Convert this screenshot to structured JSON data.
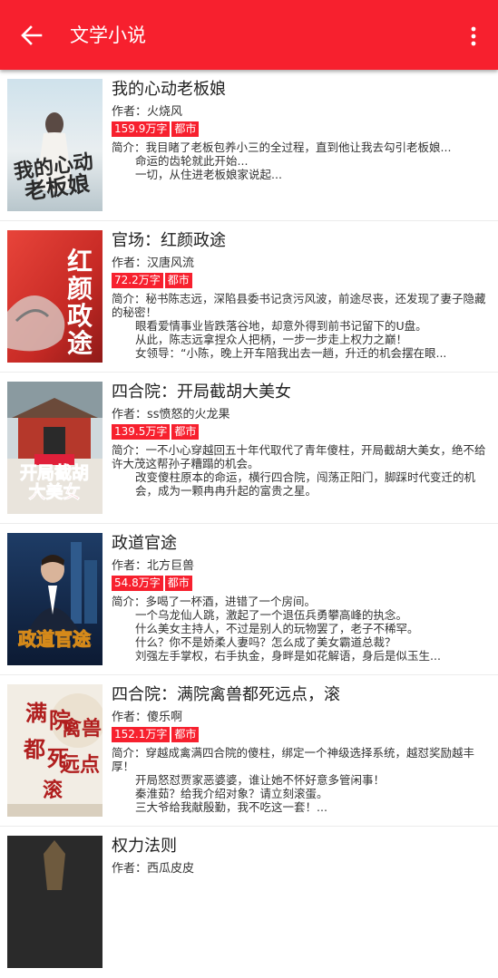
{
  "appbar": {
    "title": "文学小说",
    "back_icon": "arrow-left-icon",
    "more_icon": "more-vertical-icon",
    "background": "#f7202e"
  },
  "books": [
    {
      "title": "我的心动老板娘",
      "author": "作者：火烧风",
      "word_count": "159.9万字",
      "category": "都市",
      "cover_text": "我的心动老板娘",
      "intro": [
        "简介：我目睹了老板包养小三的全过程，直到他让我去勾引老板娘...",
        "命运的齿轮就此开始...",
        "一切，从住进老板娘家说起..."
      ]
    },
    {
      "title": "官场：红颜政途",
      "author": "作者：汉唐风流",
      "word_count": "72.2万字",
      "category": "都市",
      "cover_text": "红颜政途",
      "intro": [
        "简介：秘书陈志远，深陷县委书记贪污风波，前途尽丧，还发现了妻子隐藏的秘密！",
        "眼看爱情事业皆跌落谷地，却意外得到前书记留下的U盘。",
        "从此，陈志远拿捏众人把柄，一步一步走上权力之巅！",
        "女领导：“小陈，晚上开车陪我出去一趟，升迁的机会摆在眼..."
      ]
    },
    {
      "title": "四合院：开局截胡大美女",
      "author": "作者：ss愤怒的火龙果",
      "word_count": "139.5万字",
      "category": "都市",
      "cover_text": "开局截胡大美女",
      "intro": [
        "简介：一不小心穿越回五十年代取代了青年傻柱，开局截胡大美女，绝不给许大茂这帮孙子糟蹋的机会。",
        "改变傻柱原本的命运，横行四合院，闯荡正阳门，脚踩时代变迁的机会，成为一颗冉冉升起的富贵之星。"
      ]
    },
    {
      "title": "政道官途",
      "author": "作者：北方巨兽",
      "word_count": "54.8万字",
      "category": "都市",
      "cover_text": "政道官途",
      "intro": [
        "简介：多喝了一杯酒，进错了一个房间。",
        "一个乌龙仙人跳，激起了一个退伍兵勇攀高峰的执念。",
        "什么美女主持人，不过是别人的玩物罢了，老子不稀罕。",
        "什么？你不是娇柔人妻吗？怎么成了美女霸道总裁？",
        "刘强左手掌权，右手执金，身畔是如花解语，身后是似玉生..."
      ]
    },
    {
      "title": "四合院：满院禽兽都死远点，滚",
      "author": "作者：傻乐啊",
      "word_count": "152.1万字",
      "category": "都市",
      "cover_text": "满院禽兽都死远点滚",
      "intro": [
        "简介：穿越成禽满四合院的傻柱，绑定一个神级选择系统，越怼奖励越丰厚！",
        "开局怒怼贾家恶婆婆，谁让她不怀好意多管闲事！",
        "秦淮茹？给我介绍对象？请立刻滚蛋。",
        "三大爷给我献殷勤，我不吃这一套！..."
      ]
    },
    {
      "title": "权力法则",
      "author": "作者：西瓜皮皮",
      "word_count": "",
      "category": "",
      "cover_text": "",
      "intro": []
    }
  ]
}
